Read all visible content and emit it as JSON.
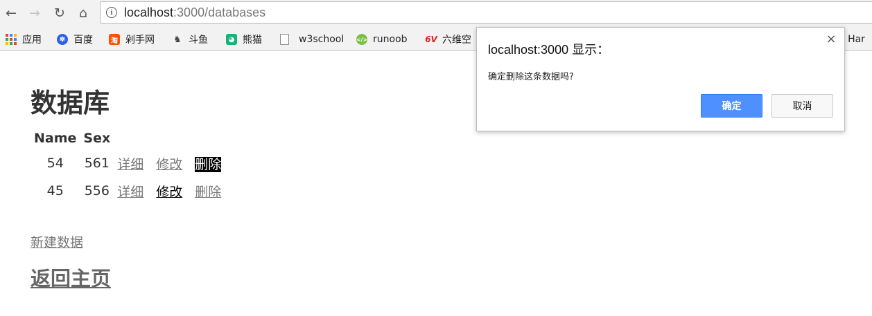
{
  "browser": {
    "url_host": "localhost",
    "url_rest": ":3000/databases",
    "bookmarks": [
      {
        "label": "应用",
        "icon": "apps-grid-icon",
        "color": "#e34234"
      },
      {
        "label": "百度",
        "icon": "baidu-paw-icon",
        "color": "#2f5ef0"
      },
      {
        "label": "剁手网",
        "icon": "taobao-icon",
        "color": "#ff5000"
      },
      {
        "label": "斗鱼",
        "icon": "douyu-fish-icon",
        "color": "#f98c00"
      },
      {
        "label": "熊猫",
        "icon": "panda-icon",
        "color": "#1cb17b"
      },
      {
        "label": "w3school",
        "icon": "page-icon",
        "color": "#666666"
      },
      {
        "label": "runoob",
        "icon": "runoob-icon",
        "color": "#7bc043"
      },
      {
        "label": "六维空",
        "icon": "6v-icon",
        "color": "#d9231f"
      }
    ],
    "bookmark_overflow": "e Har"
  },
  "page": {
    "title": "数据库",
    "table": {
      "headers": [
        "Name",
        "Sex"
      ],
      "rows": [
        {
          "name": "54",
          "sex": "561",
          "detail": "详细",
          "edit": "修改",
          "delete": "删除"
        },
        {
          "name": "45",
          "sex": "556",
          "detail": "详细",
          "edit": "修改",
          "delete": "删除"
        }
      ]
    },
    "new_link": "新建数据",
    "home_link": "返回主页"
  },
  "dialog": {
    "title": "localhost:3000 显示：",
    "message": "确定删除这条数据吗?",
    "ok": "确定",
    "cancel": "取消",
    "close_glyph": "×"
  }
}
